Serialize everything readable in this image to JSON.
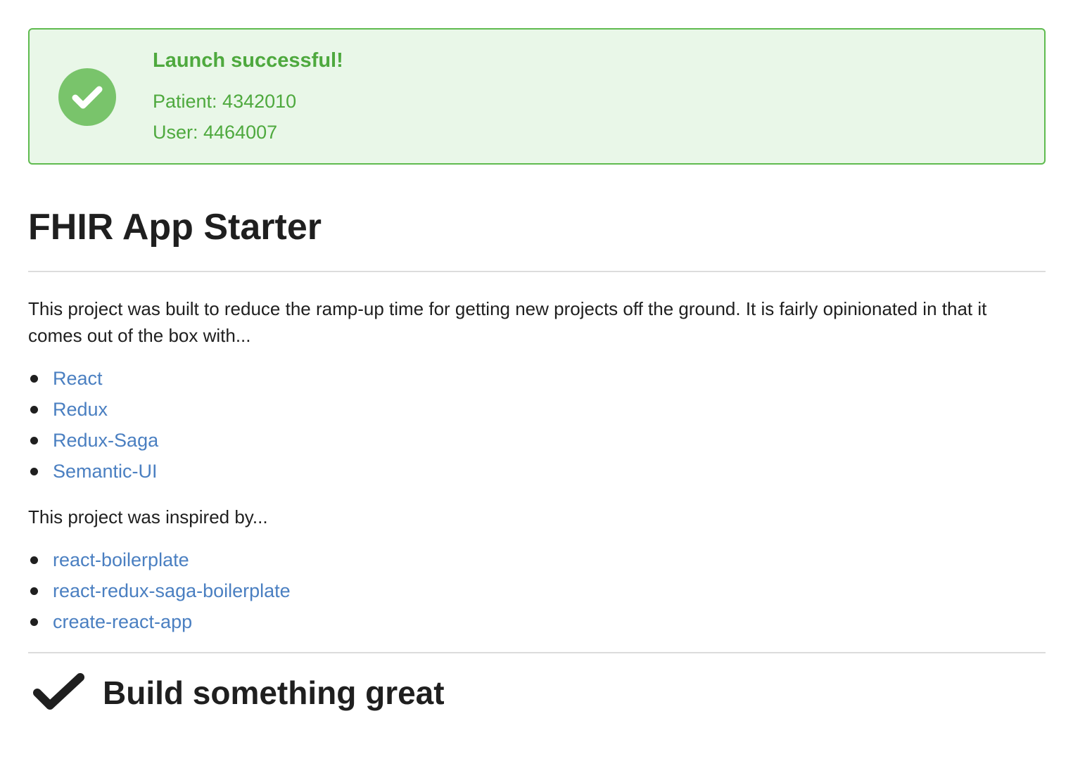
{
  "message": {
    "title": "Launch successful!",
    "patient": "Patient: 4342010",
    "user": "User: 4464007",
    "icon": "check-circle-icon",
    "color": "#4ea93e",
    "background": "#e9f7e8"
  },
  "header": {
    "title": "FHIR App Starter"
  },
  "intro": {
    "text": "This project was built to reduce the ramp-up time for getting new projects off the ground. It is fairly opinionated in that it comes out of the box with..."
  },
  "stack": {
    "items": [
      {
        "label": "React"
      },
      {
        "label": "Redux"
      },
      {
        "label": "Redux-Saga"
      },
      {
        "label": "Semantic-UI"
      }
    ]
  },
  "inspired": {
    "text": "This project was inspired by...",
    "items": [
      {
        "label": "react-boilerplate"
      },
      {
        "label": "react-redux-saga-boilerplate"
      },
      {
        "label": "create-react-app"
      }
    ]
  },
  "footer": {
    "title": "Build something great",
    "icon": "checkmark-icon"
  },
  "colors": {
    "link": "#4a7fc1",
    "text": "#1f1f1f"
  }
}
